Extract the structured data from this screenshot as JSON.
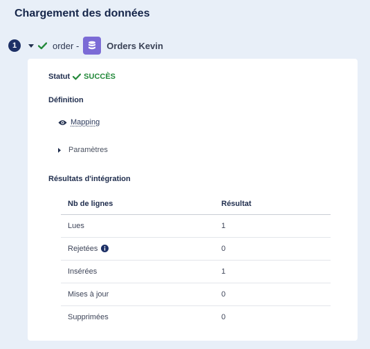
{
  "header": {
    "title": "Chargement des données"
  },
  "step": {
    "number": "1",
    "name": "order -",
    "source_name": "Orders Kevin"
  },
  "colors": {
    "success": "#23893a",
    "badge": "#1d3066",
    "db": "#7b6bd6"
  },
  "panel": {
    "status_label": "Statut",
    "status_value": "SUCCÈS",
    "definition_title": "Définition",
    "mapping_label": "Mapping",
    "params_label": "Paramètres",
    "results_title": "Résultats d'intégration",
    "table": {
      "headers": [
        "Nb de lignes",
        "Résultat"
      ],
      "rows": [
        {
          "label": "Lues",
          "value": "1"
        },
        {
          "label": "Rejetées",
          "value": "0"
        },
        {
          "label": "Insérées",
          "value": "1"
        },
        {
          "label": "Mises à jour",
          "value": "0"
        },
        {
          "label": "Supprimées",
          "value": "0"
        }
      ]
    }
  }
}
